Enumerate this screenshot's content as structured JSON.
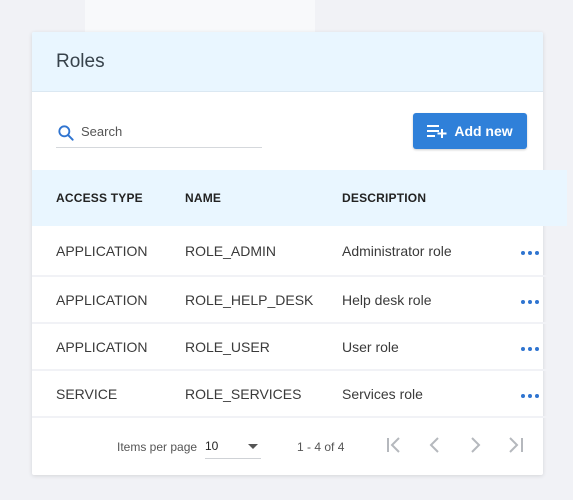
{
  "header": {
    "title": "Roles"
  },
  "search": {
    "placeholder": "Search",
    "value": ""
  },
  "toolbar": {
    "add_label": "Add new"
  },
  "table": {
    "columns": [
      "ACCESS TYPE",
      "NAME",
      "DESCRIPTION"
    ],
    "rows": [
      {
        "access_type": "APPLICATION",
        "name": "ROLE_ADMIN",
        "description": "Administrator role"
      },
      {
        "access_type": "APPLICATION",
        "name": "ROLE_HELP_DESK",
        "description": "Help desk role"
      },
      {
        "access_type": "APPLICATION",
        "name": "ROLE_USER",
        "description": "User role"
      },
      {
        "access_type": "SERVICE",
        "name": "ROLE_SERVICES",
        "description": "Services role"
      }
    ]
  },
  "pagination": {
    "items_per_page_label": "Items per page",
    "items_per_page": "10",
    "range": "1 - 4 of 4",
    "icons": [
      "first-page-icon",
      "prev-page-icon",
      "next-page-icon",
      "last-page-icon"
    ]
  },
  "colors": {
    "accent": "#2f80d9",
    "header_bg": "#e9f6ff",
    "row_action": "#2f74d0"
  }
}
